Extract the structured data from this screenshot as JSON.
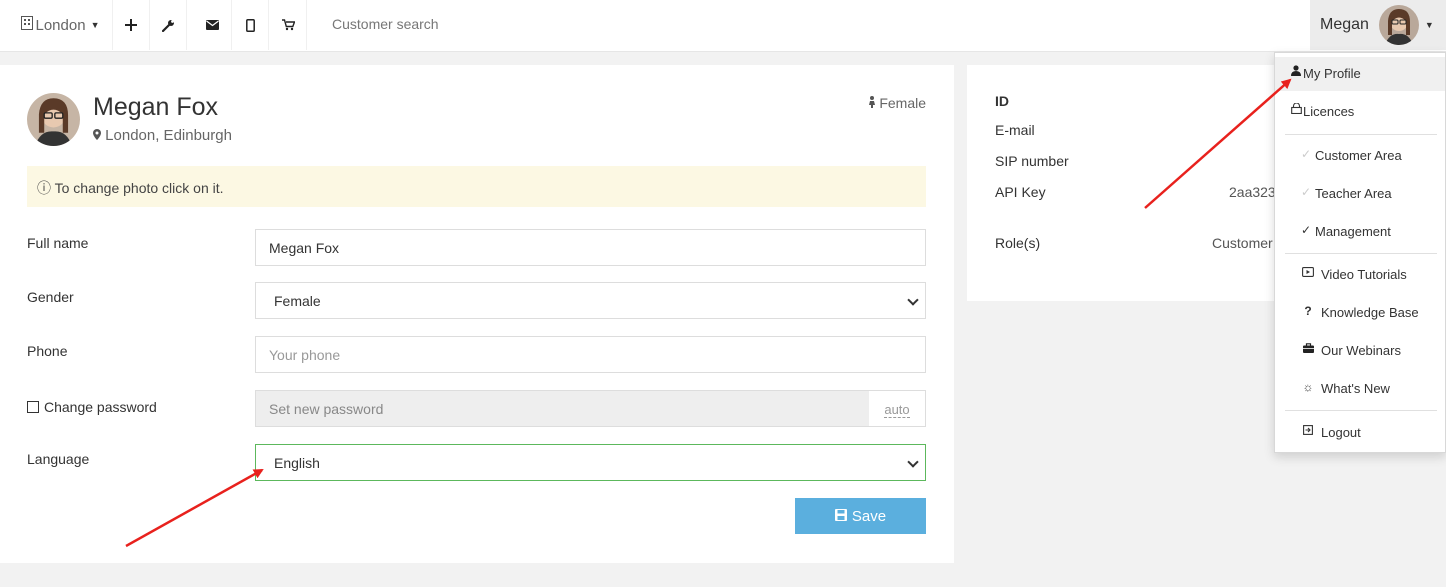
{
  "navbar": {
    "branch": "London",
    "search_placeholder": "Customer search",
    "icons": [
      "building-icon",
      "plus-icon",
      "wrench-icon",
      "envelope-icon",
      "mobile-icon",
      "cart-icon"
    ],
    "user_name": "Megan"
  },
  "profile": {
    "name": "Megan Fox",
    "location": "London, Edinburgh",
    "gender_tag": "Female",
    "photo_hint": "ⓘ To change photo click on it."
  },
  "form": {
    "full_name_label": "Full name",
    "full_name_value": "Megan Fox",
    "gender_label": "Gender",
    "gender_value": "Female",
    "phone_label": "Phone",
    "phone_placeholder": "Your phone",
    "password_label": "Change password",
    "password_placeholder": "Set new password",
    "password_addon": "auto",
    "language_label": "Language",
    "language_value": "English",
    "save_label": "Save"
  },
  "account": {
    "id_label": "ID",
    "email_label": "E-mail",
    "sip_label": "SIP number",
    "api_label": "API Key",
    "api_value": "2aa323",
    "roles_label": "Role(s)",
    "roles_value": "Customer"
  },
  "menu": {
    "items": [
      {
        "label": "My Profile",
        "icon": "user-icon"
      },
      {
        "label": "Licences",
        "icon": "lock-icon"
      },
      {
        "label": "Customer Area",
        "icon": "check-icon"
      },
      {
        "label": "Teacher Area",
        "icon": "check-icon"
      },
      {
        "label": "Management",
        "icon": "check-icon"
      },
      {
        "label": "Video Tutorials",
        "icon": "video-icon"
      },
      {
        "label": "Knowledge Base",
        "icon": "question-icon"
      },
      {
        "label": "Our Webinars",
        "icon": "briefcase-icon"
      },
      {
        "label": "What's New",
        "icon": "sun-icon"
      },
      {
        "label": "Logout",
        "icon": "logout-icon"
      }
    ]
  },
  "colors": {
    "save_button": "#5bafde",
    "alert_bg": "#fcf8e3",
    "annotation_arrow": "#e8211d"
  }
}
